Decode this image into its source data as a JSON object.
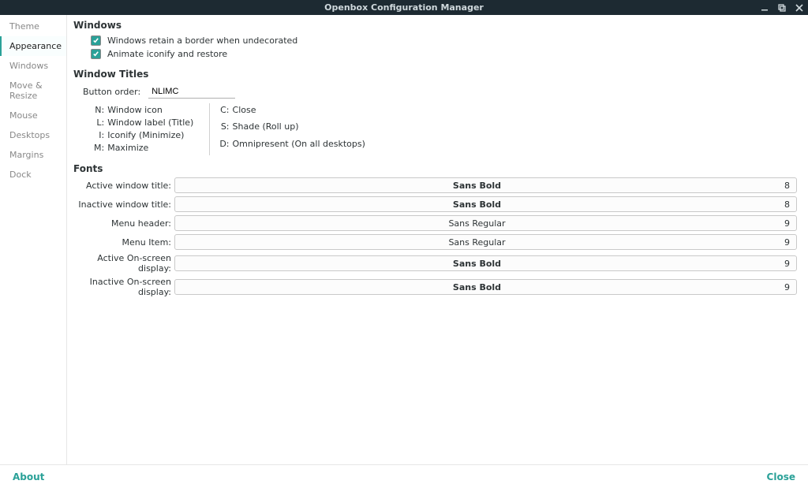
{
  "title": "Openbox Configuration Manager",
  "sidebar": {
    "items": [
      {
        "label": "Theme"
      },
      {
        "label": "Appearance"
      },
      {
        "label": "Windows"
      },
      {
        "label": "Move & Resize"
      },
      {
        "label": "Mouse"
      },
      {
        "label": "Desktops"
      },
      {
        "label": "Margins"
      },
      {
        "label": "Dock"
      }
    ],
    "active_index": 1
  },
  "windows_section": {
    "title": "Windows",
    "retain_border": {
      "checked": true,
      "label": "Windows retain a border when undecorated"
    },
    "animate_iconify": {
      "checked": true,
      "label": "Animate iconify and restore"
    }
  },
  "window_titles_section": {
    "title": "Window Titles",
    "button_order_label": "Button order:",
    "button_order_value": "NLIMC",
    "legend_left": [
      {
        "k": "N:",
        "v": "Window icon"
      },
      {
        "k": "L:",
        "v": "Window label (Title)"
      },
      {
        "k": "I:",
        "v": "Iconify (Minimize)"
      },
      {
        "k": "M:",
        "v": "Maximize"
      }
    ],
    "legend_right": [
      {
        "k": "C:",
        "v": "Close"
      },
      {
        "k": "S:",
        "v": "Shade (Roll up)"
      },
      {
        "k": "D:",
        "v": "Omnipresent (On all desktops)"
      }
    ]
  },
  "fonts_section": {
    "title": "Fonts",
    "rows": [
      {
        "label": "Active window title:",
        "font": "Sans Bold",
        "size": "8",
        "bold": true
      },
      {
        "label": "Inactive window title:",
        "font": "Sans Bold",
        "size": "8",
        "bold": true
      },
      {
        "label": "Menu header:",
        "font": "Sans Regular",
        "size": "9",
        "bold": false
      },
      {
        "label": "Menu Item:",
        "font": "Sans Regular",
        "size": "9",
        "bold": false
      },
      {
        "label": "Active On-screen display:",
        "font": "Sans Bold",
        "size": "9",
        "bold": true
      },
      {
        "label": "Inactive On-screen display:",
        "font": "Sans Bold",
        "size": "9",
        "bold": true
      }
    ]
  },
  "footer": {
    "about": "About",
    "close": "Close"
  }
}
